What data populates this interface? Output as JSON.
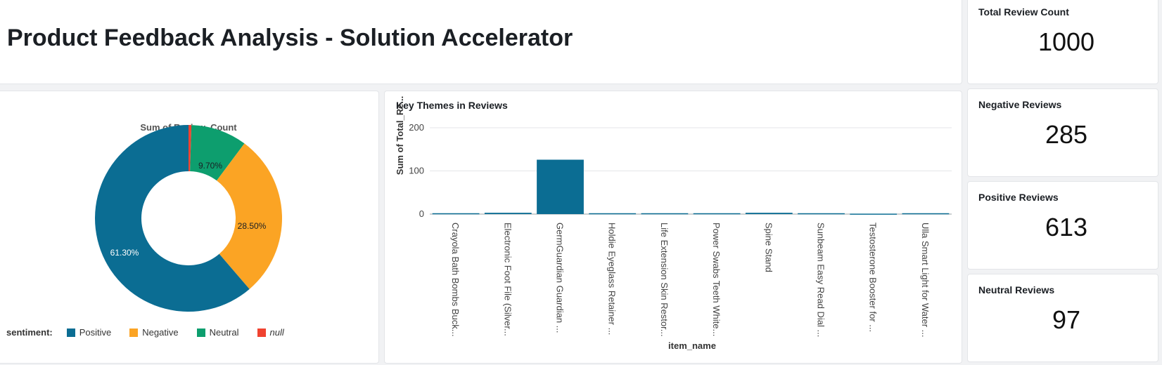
{
  "header": {
    "title": "Product Feedback Analysis - Solution Accelerator"
  },
  "kpis": [
    {
      "label": "Total Review Count",
      "value": "1000"
    },
    {
      "label": "Negative Reviews",
      "value": "285"
    },
    {
      "label": "Positive Reviews",
      "value": "613"
    },
    {
      "label": "Neutral Reviews",
      "value": "97"
    }
  ],
  "donut": {
    "title": "Sum of Review_Count",
    "legend_title": "sentiment:",
    "legend": [
      {
        "label": "Positive",
        "color": "#0b6d93"
      },
      {
        "label": "Negative",
        "color": "#fba424"
      },
      {
        "label": "Neutral",
        "color": "#0d9e6e"
      },
      {
        "label": "null",
        "color": "#f04330"
      }
    ],
    "slice_labels": [
      "61.30%",
      "28.50%",
      "9.70%"
    ]
  },
  "bar_panel": {
    "title": "Key Themes in Reviews"
  },
  "chart_data": [
    {
      "type": "pie",
      "title": "Sum of Review_Count",
      "categories": [
        "null",
        "Neutral",
        "Negative",
        "Positive"
      ],
      "values": [
        0.5,
        9.7,
        28.5,
        61.3
      ],
      "colors": [
        "#f04330",
        "#0d9e6e",
        "#fba424",
        "#0b6d93"
      ],
      "legend_placement": "bottom"
    },
    {
      "type": "bar",
      "title": "Key Themes in Reviews",
      "xlabel": "item_name",
      "ylabel": "Sum of Total_Re...",
      "ylim": [
        0,
        200
      ],
      "yticks": [
        0,
        100,
        200
      ],
      "grid": true,
      "color": "#0b6d93",
      "categories": [
        "Crayola Bath Bombs Buck...",
        "Electronic Foot File (Silver...",
        "GermGuardian Guardian ...",
        "Holdie Eyeglass Retainer ...",
        "Life Extension Skin Restor...",
        "Power Swabs Teeth White...",
        "Spine Stand",
        "Sunbeam Easy Read Dial ...",
        "Testosterone Booster for ...",
        "Ulla Smart Light for Water ..."
      ],
      "values": [
        2,
        3,
        126,
        2,
        2,
        2,
        3,
        2,
        1,
        2
      ]
    }
  ]
}
